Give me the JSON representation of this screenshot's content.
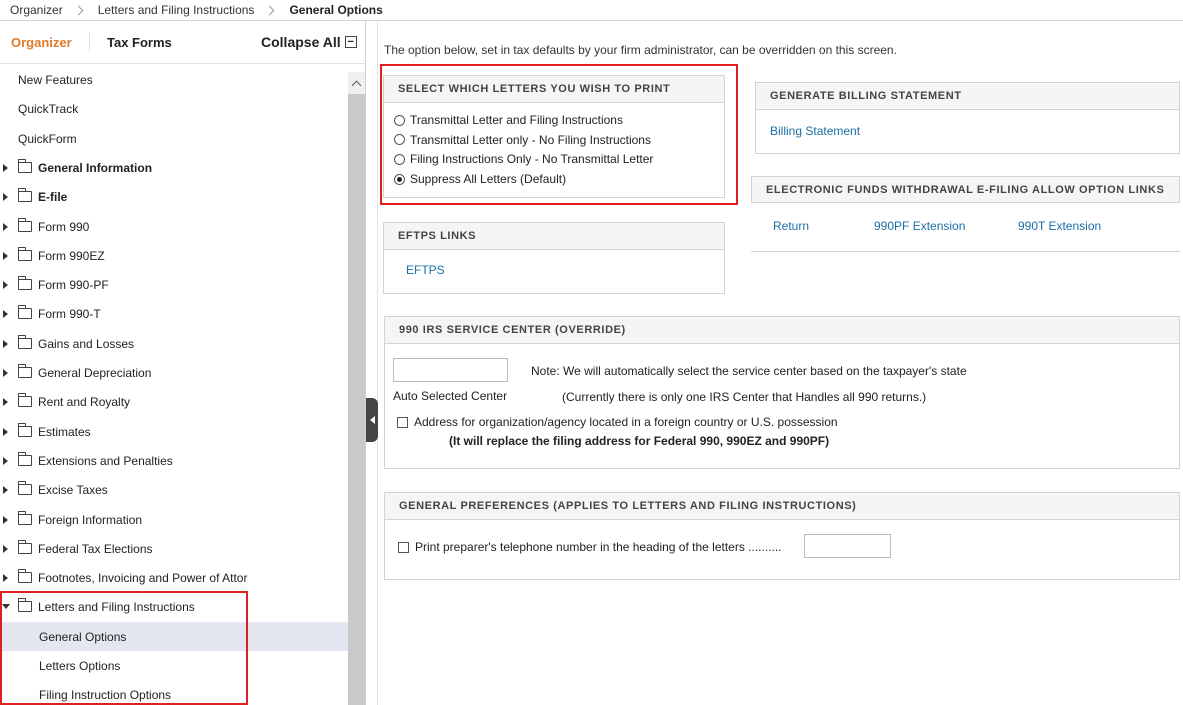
{
  "breadcrumb": [
    "Organizer",
    "Letters and Filing Instructions",
    "General Options"
  ],
  "sidebar": {
    "tab_organizer": "Organizer",
    "tab_tax_forms": "Tax Forms",
    "collapse_all": "Collapse All",
    "items": [
      {
        "label": "New Features",
        "type": "plain"
      },
      {
        "label": "QuickTrack",
        "type": "plain"
      },
      {
        "label": "QuickForm",
        "type": "plain"
      },
      {
        "label": "General Information",
        "type": "folder",
        "bold": true
      },
      {
        "label": "E-file",
        "type": "folder",
        "bold": true
      },
      {
        "label": "Form 990",
        "type": "folder"
      },
      {
        "label": "Form 990EZ",
        "type": "folder"
      },
      {
        "label": "Form 990-PF",
        "type": "folder"
      },
      {
        "label": "Form 990-T",
        "type": "folder"
      },
      {
        "label": "Gains and Losses",
        "type": "folder"
      },
      {
        "label": "General Depreciation",
        "type": "folder"
      },
      {
        "label": "Rent and Royalty",
        "type": "folder"
      },
      {
        "label": "Estimates",
        "type": "folder"
      },
      {
        "label": "Extensions and Penalties",
        "type": "folder"
      },
      {
        "label": "Excise Taxes",
        "type": "folder"
      },
      {
        "label": "Foreign Information",
        "type": "folder"
      },
      {
        "label": "Federal Tax Elections",
        "type": "folder"
      },
      {
        "label": "Footnotes, Invoicing and Power of Attor",
        "type": "folder"
      },
      {
        "label": "Letters and Filing Instructions",
        "type": "folder",
        "open": true
      },
      {
        "label": "General Options",
        "type": "child",
        "selected": true
      },
      {
        "label": "Letters Options",
        "type": "child"
      },
      {
        "label": "Filing Instruction Options",
        "type": "child"
      }
    ]
  },
  "main": {
    "intro": "The option below, set in tax defaults by your firm administrator, can be overridden on this screen.",
    "letters_panel": {
      "title": "SELECT WHICH LETTERS YOU WISH TO PRINT",
      "options": [
        "Transmittal Letter and Filing Instructions",
        "Transmittal Letter only - No Filing Instructions",
        "Filing Instructions Only - No Transmittal Letter",
        "Suppress All Letters (Default)"
      ],
      "selected": "Suppress All Letters (Default)"
    },
    "billing_panel": {
      "title": "GENERATE BILLING STATEMENT",
      "link": "Billing Statement"
    },
    "efw_panel": {
      "title": "ELECTRONIC FUNDS WITHDRAWAL E-FILING ALLOW OPTION LINKS",
      "links": [
        "Return",
        "990PF Extension",
        "990T Extension"
      ]
    },
    "eftps_panel": {
      "title": "EFTPS LINKS",
      "link": "EFTPS"
    },
    "irs_panel": {
      "title": "990 IRS SERVICE CENTER (OVERRIDE)",
      "input_value": "",
      "auto_label": "Auto Selected Center",
      "note": "Note: We will automatically select the service center based on the taxpayer's state",
      "note2": "(Currently there is only one IRS Center that Handles all 990 returns.)",
      "foreign_label": "Address for organization/agency located in a foreign country or U.S. possession",
      "foreign_note": "(It will replace the filing address for Federal 990, 990EZ and 990PF)"
    },
    "prefs_panel": {
      "title": "GENERAL PREFERENCES (APPLIES TO LETTERS AND FILING INSTRUCTIONS)",
      "phone_label": "Print preparer's telephone number in the heading of the letters ..........",
      "phone_value": ""
    }
  },
  "colors": {
    "accent": "#e07b2a",
    "link": "#1a6fa3",
    "highlight": "#e02020",
    "selected_row": "#e4e7ef"
  }
}
